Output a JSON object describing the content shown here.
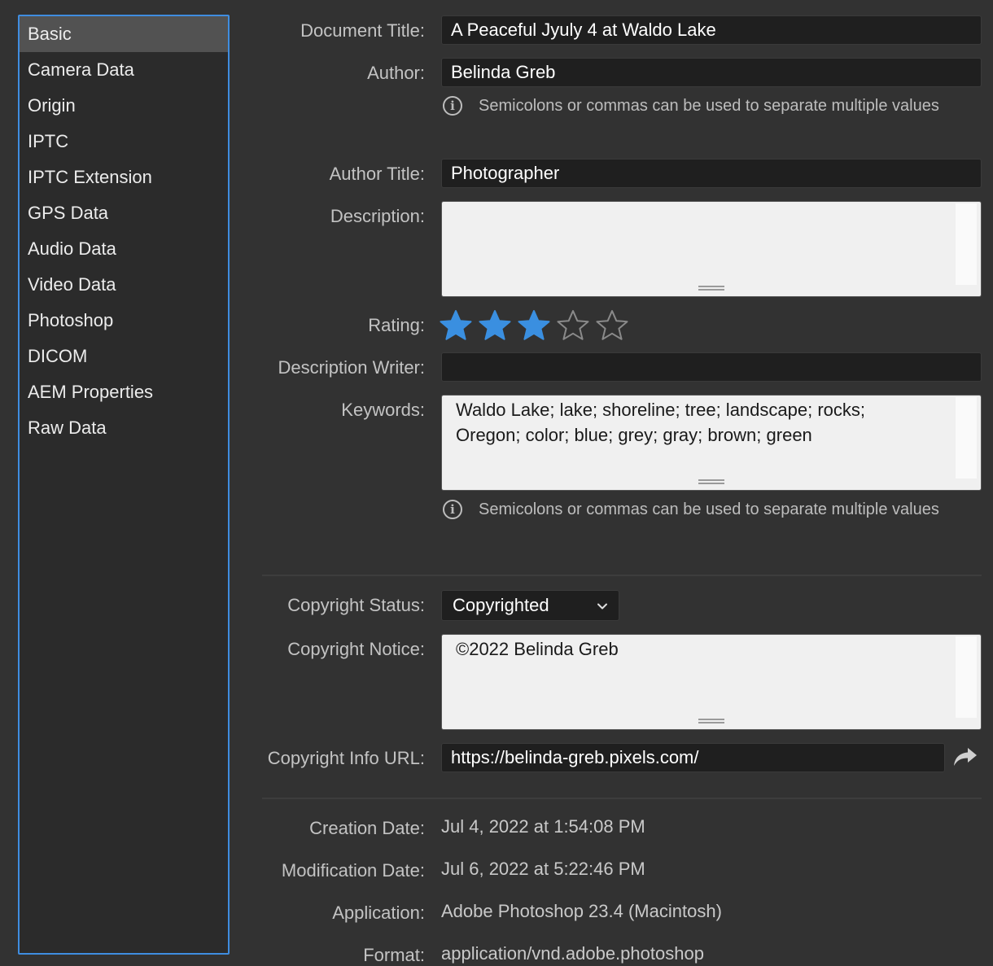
{
  "sidebar": {
    "items": [
      {
        "label": "Basic"
      },
      {
        "label": "Camera Data"
      },
      {
        "label": "Origin"
      },
      {
        "label": "IPTC"
      },
      {
        "label": "IPTC Extension"
      },
      {
        "label": "GPS Data"
      },
      {
        "label": "Audio Data"
      },
      {
        "label": "Video Data"
      },
      {
        "label": "Photoshop"
      },
      {
        "label": "DICOM"
      },
      {
        "label": "AEM Properties"
      },
      {
        "label": "Raw Data"
      }
    ],
    "selected": "Basic"
  },
  "form": {
    "document_title": {
      "label": "Document Title:",
      "value": "A Peaceful Jyuly 4 at Waldo Lake"
    },
    "author": {
      "label": "Author:",
      "value": "Belinda Greb"
    },
    "author_hint": "Semicolons or commas can be used to separate multiple values",
    "author_title": {
      "label": "Author Title:",
      "value": "Photographer"
    },
    "description": {
      "label": "Description:",
      "value": ""
    },
    "rating": {
      "label": "Rating:",
      "value": 3,
      "max": 5
    },
    "description_writer": {
      "label": "Description Writer:",
      "value": ""
    },
    "keywords": {
      "label": "Keywords:",
      "value": "Waldo Lake; lake; shoreline; tree; landscape; rocks; Oregon; color; blue; grey; gray; brown; green"
    },
    "keywords_hint": "Semicolons or commas can be used to separate multiple values",
    "copyright_status": {
      "label": "Copyright Status:",
      "value": "Copyrighted"
    },
    "copyright_notice": {
      "label": "Copyright Notice:",
      "value": "©2022 Belinda Greb"
    },
    "copyright_url": {
      "label": "Copyright Info URL:",
      "value": "https://belinda-greb.pixels.com/"
    },
    "creation_date": {
      "label": "Creation Date:",
      "value": "Jul 4, 2022 at 1:54:08 PM"
    },
    "modification_date": {
      "label": "Modification Date:",
      "value": "Jul 6, 2022 at 5:22:46 PM"
    },
    "application": {
      "label": "Application:",
      "value": "Adobe Photoshop 23.4 (Macintosh)"
    },
    "format": {
      "label": "Format:",
      "value": "application/vnd.adobe.photoshop"
    }
  },
  "colors": {
    "accent": "#3f8de0",
    "star_filled": "#3a8fe0",
    "star_empty": "#8a8a8a"
  }
}
